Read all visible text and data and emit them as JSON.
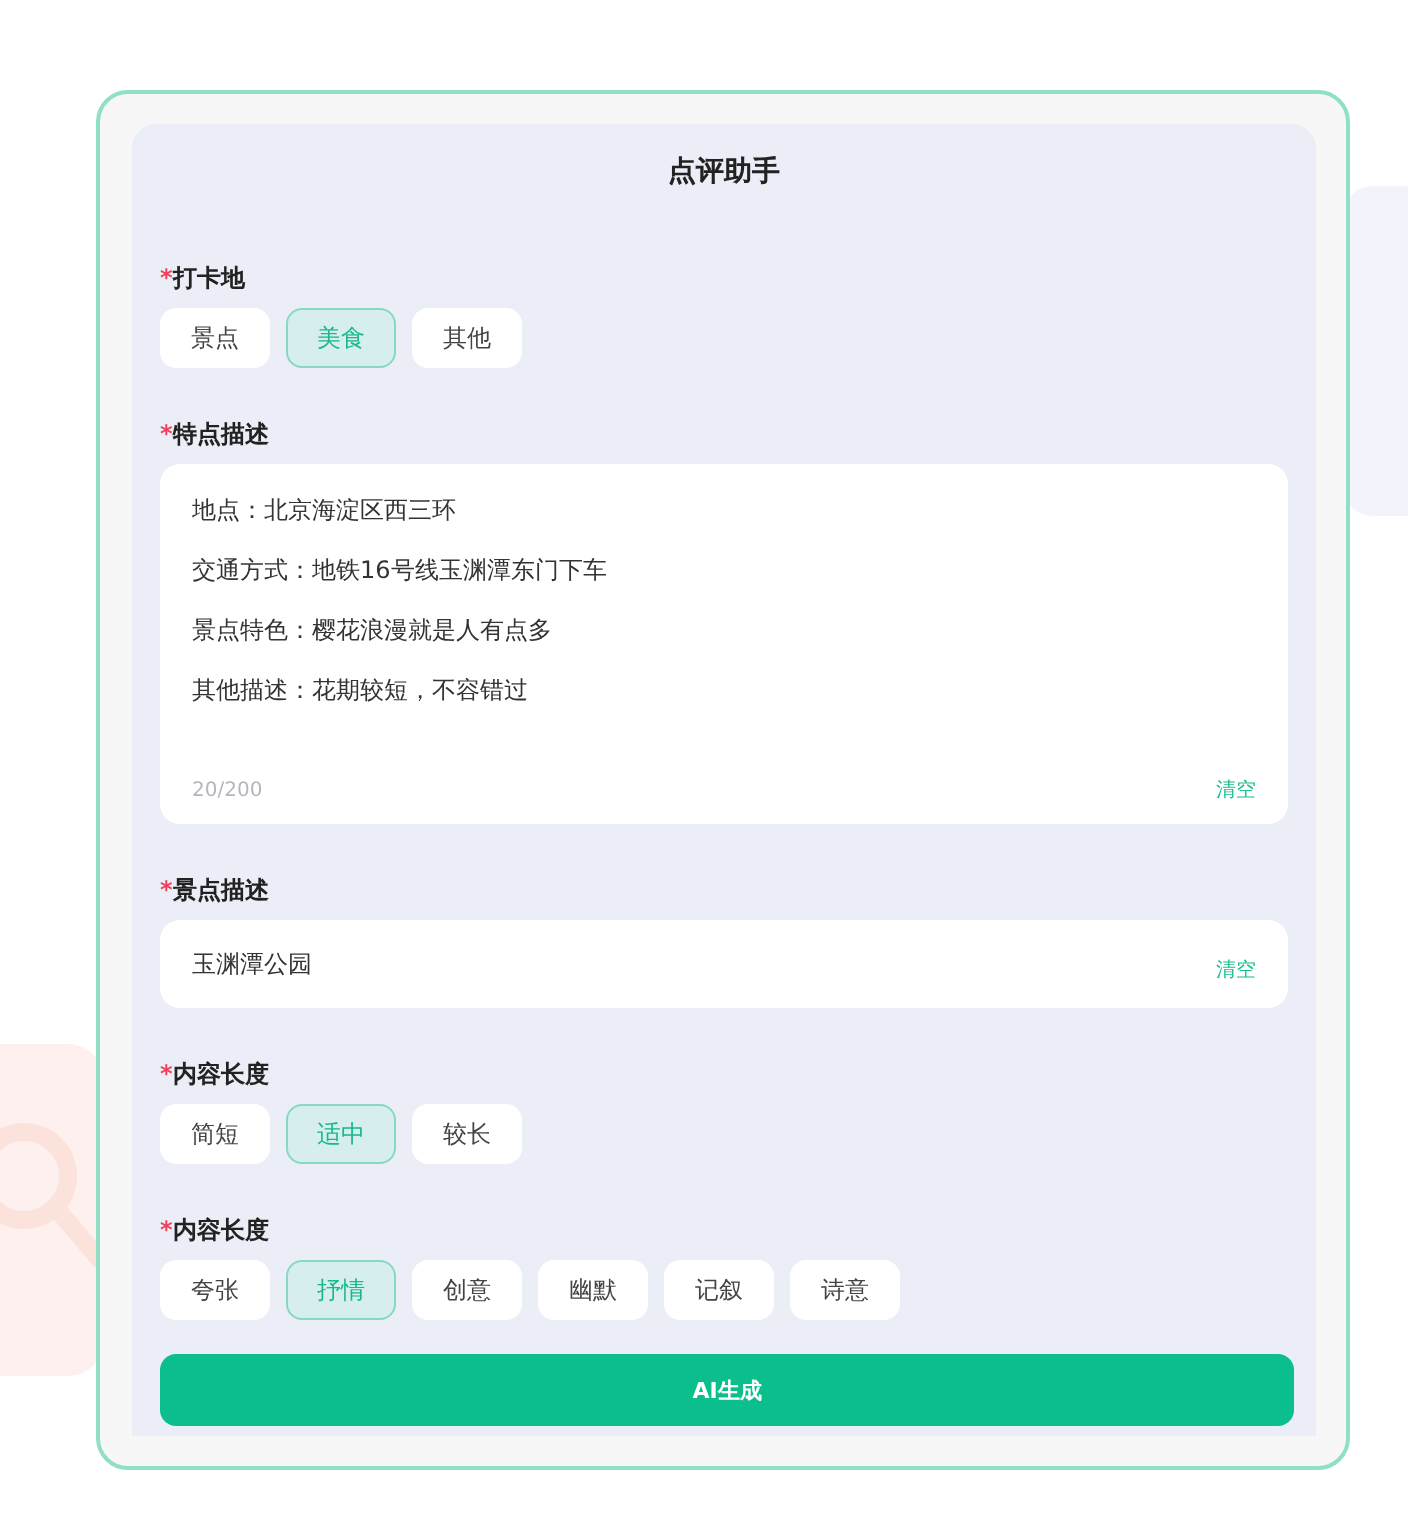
{
  "title": "点评助手",
  "sections": [
    {
      "kind": "chips",
      "required_mark": "*",
      "label": "打卡地",
      "options": [
        {
          "label": "景点",
          "selected": false
        },
        {
          "label": "美食",
          "selected": true
        },
        {
          "label": "其他",
          "selected": false
        }
      ]
    },
    {
      "kind": "textarea",
      "required_mark": "*",
      "label": "特点描述",
      "lines": [
        "地点：北京海淀区西三环",
        "交通方式：地铁16号线玉渊潭东门下车",
        "景点特色：樱花浪漫就是人有点多",
        "其他描述：花期较短，不容错过"
      ],
      "counter": "20/200",
      "clear": "清空"
    },
    {
      "kind": "input",
      "required_mark": "*",
      "label": "景点描述",
      "value": "玉渊潭公园",
      "clear": "清空"
    },
    {
      "kind": "chips",
      "required_mark": "*",
      "label": "内容长度",
      "options": [
        {
          "label": "简短",
          "selected": false
        },
        {
          "label": "适中",
          "selected": true
        },
        {
          "label": "较长",
          "selected": false
        }
      ]
    },
    {
      "kind": "chips",
      "required_mark": "*",
      "label": "内容长度",
      "options": [
        {
          "label": "夸张",
          "selected": false
        },
        {
          "label": "抒情",
          "selected": true
        },
        {
          "label": "创意",
          "selected": false
        },
        {
          "label": "幽默",
          "selected": false
        },
        {
          "label": "记叙",
          "selected": false
        },
        {
          "label": "诗意",
          "selected": false
        }
      ]
    }
  ],
  "submit": "AI生成"
}
